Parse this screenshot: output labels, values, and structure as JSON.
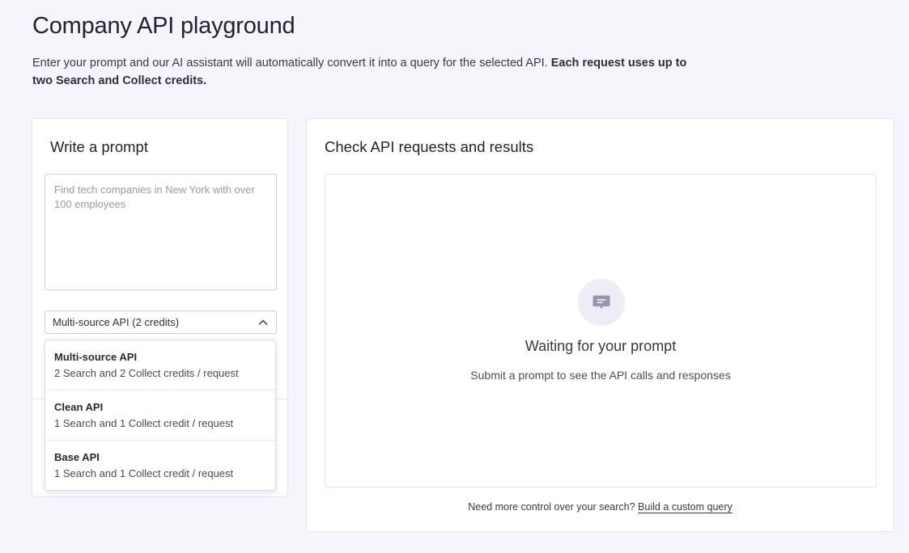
{
  "header": {
    "title": "Company API playground",
    "intro_text": "Enter your prompt and our AI assistant will automatically convert it into a query for the selected API. ",
    "intro_bold": "Each request uses up to two Search and Collect credits."
  },
  "prompt_card": {
    "heading": "Write a prompt",
    "prompt_value": "",
    "prompt_placeholder": "Find tech companies in New York with over 100 employees",
    "api_select": {
      "selected_label": "Multi-source API (2 credits)",
      "icon": "chevron-up-icon",
      "expanded": true
    },
    "api_options": [
      {
        "name": "Multi-source API",
        "description": "2 Search and 2 Collect credits / request"
      },
      {
        "name": "Clean API",
        "description": "1 Search and 1 Collect credit / request"
      },
      {
        "name": "Base API",
        "description": "1 Search and 1 Collect credit / request"
      }
    ]
  },
  "results_card": {
    "heading": "Check API requests and results",
    "empty_state": {
      "icon": "chat-bubble-icon",
      "title": "Waiting for your prompt",
      "subtitle": "Submit a prompt to see the API calls and responses"
    },
    "footer_text": "Need more control over your search? ",
    "footer_link": "Build a custom query"
  },
  "colors": {
    "page_background": "#f6f5fc",
    "card_background": "#ffffff",
    "icon_circle": "#eeedf7",
    "icon_fill": "#9896ad"
  }
}
